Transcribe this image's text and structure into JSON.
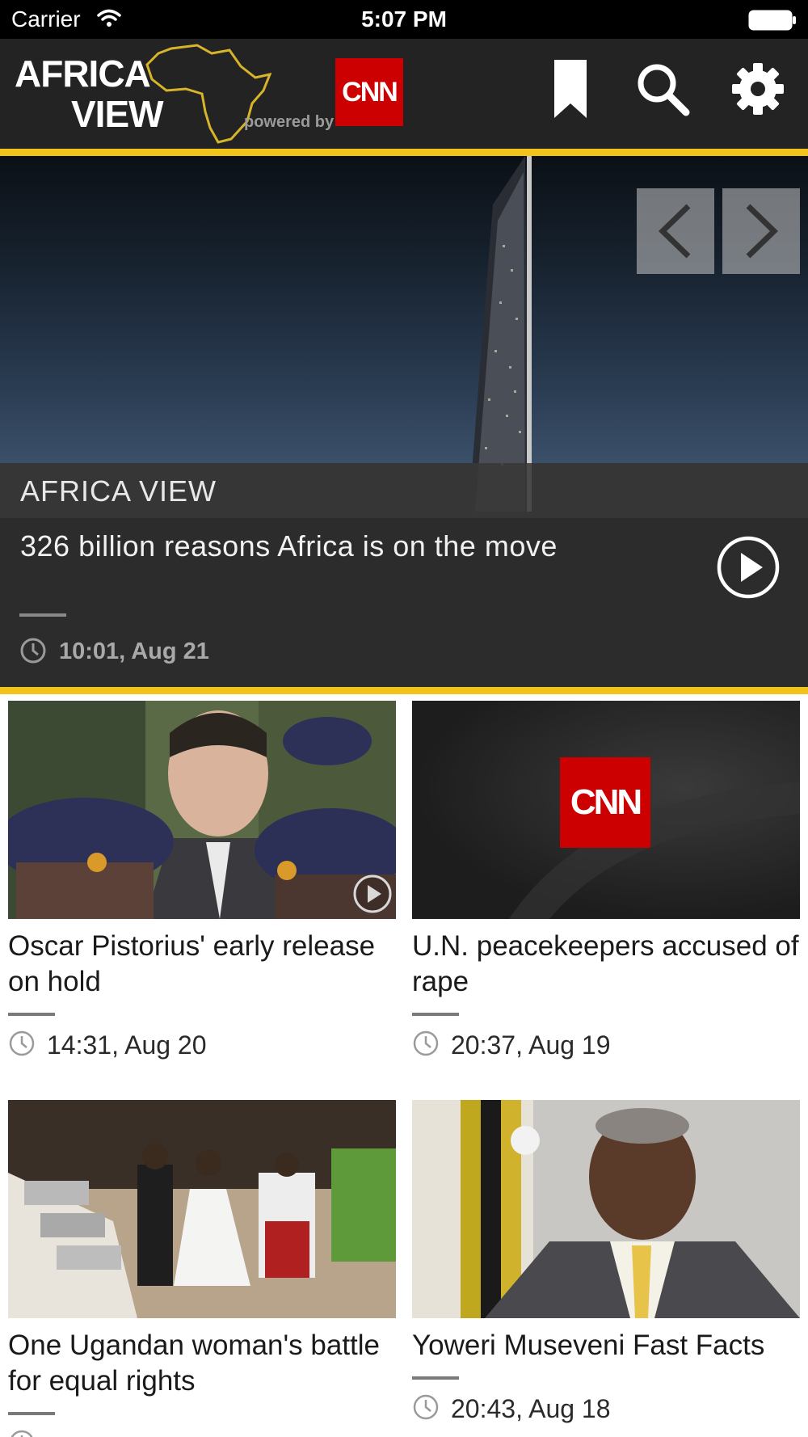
{
  "status_bar": {
    "carrier": "Carrier",
    "time": "5:07 PM",
    "wifi_icon": "wifi-icon",
    "battery_icon": "battery-icon"
  },
  "header": {
    "logo_line1": "AFRICA",
    "logo_line2": "VIEW",
    "powered_by": "powered by",
    "cnn_logo_text": "CNN",
    "icons": [
      "bookmark-icon",
      "search-icon",
      "gear-icon"
    ],
    "accent_color": "#f2c31b",
    "brand_red": "#cc0000"
  },
  "hero": {
    "kicker": "AFRICA VIEW",
    "headline": "326 billion reasons Africa is on the move",
    "timestamp": "10:01, Aug 21",
    "icons": [
      "chevron-left-icon",
      "chevron-right-icon",
      "play-icon",
      "clock-icon"
    ]
  },
  "articles": [
    {
      "title": "Oscar Pistorius' early release on hold",
      "timestamp": "14:31, Aug 20",
      "has_video": true
    },
    {
      "title": "U.N. peacekeepers accused of rape",
      "timestamp": "20:37, Aug 19",
      "thumb_logo": "CNN"
    },
    {
      "title": "One Ugandan woman's battle for equal rights",
      "timestamp": ""
    },
    {
      "title": "Yoweri Museveni Fast Facts",
      "timestamp": "20:43, Aug 18"
    }
  ]
}
